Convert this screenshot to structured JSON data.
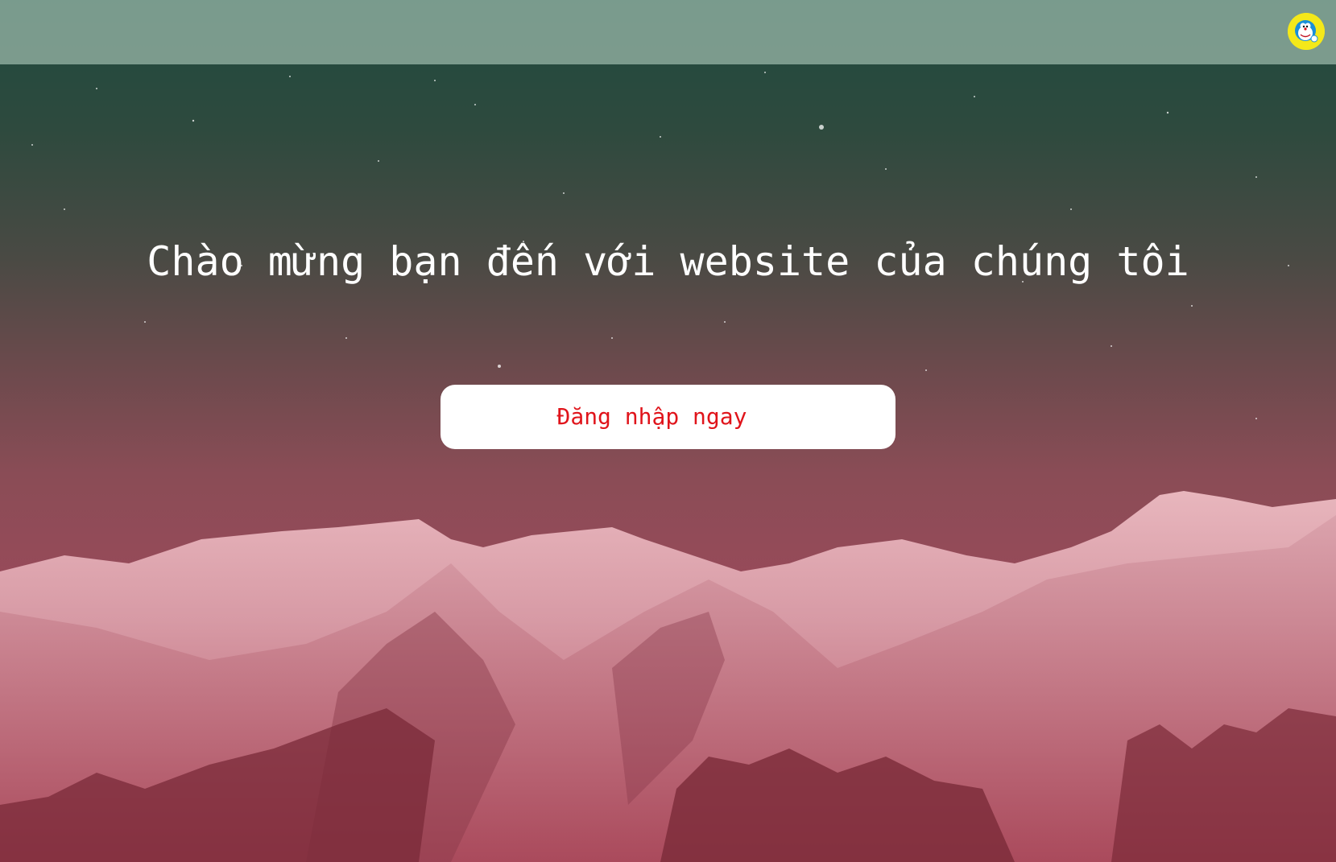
{
  "header": {
    "avatar_icon": "doraemon-avatar-icon",
    "background_color": "#b2cdbe"
  },
  "hero": {
    "title": "Chào mừng bạn đến với website của chúng tôi",
    "login_button_label": "Đăng nhập ngay",
    "login_button_text_color": "#e0141b",
    "background_image": "starry-sky-snowy-mountains"
  }
}
